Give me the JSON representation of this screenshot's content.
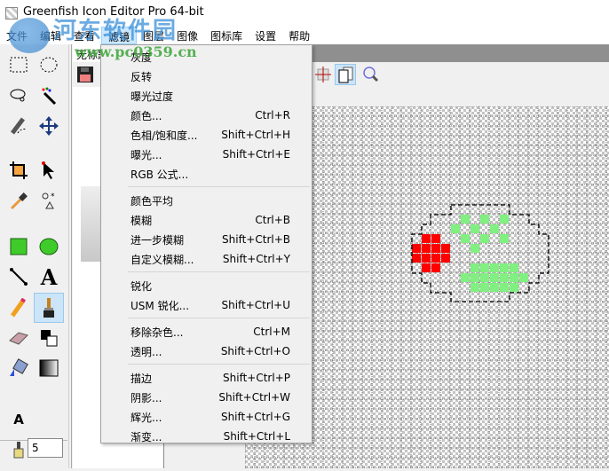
{
  "window": {
    "title": "Greenfish Icon Editor Pro 64-bit"
  },
  "watermark": {
    "text": "河东软件园",
    "url": "www.pc0359.cn"
  },
  "menubar": [
    "文件",
    "编辑",
    "查看",
    "滤镜",
    "图层",
    "图像",
    "图标库",
    "设置",
    "帮助"
  ],
  "active_menu": "滤镜",
  "document": {
    "tab_title": "无标题"
  },
  "brush_size": "5",
  "filter_menu": {
    "groups": [
      [
        {
          "label": "灰度",
          "shortcut": ""
        },
        {
          "label": "反转",
          "shortcut": ""
        },
        {
          "label": "曝光过度",
          "shortcut": ""
        },
        {
          "label": "颜色...",
          "shortcut": "Ctrl+R"
        },
        {
          "label": "色相/饱和度...",
          "shortcut": "Shift+Ctrl+H"
        },
        {
          "label": "曝光...",
          "shortcut": "Shift+Ctrl+E"
        },
        {
          "label": "RGB 公式...",
          "shortcut": ""
        }
      ],
      [
        {
          "label": "颜色平均",
          "shortcut": ""
        },
        {
          "label": "模糊",
          "shortcut": "Ctrl+B"
        },
        {
          "label": "进一步模糊",
          "shortcut": "Shift+Ctrl+B"
        },
        {
          "label": "自定义模糊...",
          "shortcut": "Shift+Ctrl+Y"
        }
      ],
      [
        {
          "label": "锐化",
          "shortcut": ""
        },
        {
          "label": "USM 锐化...",
          "shortcut": "Shift+Ctrl+U"
        }
      ],
      [
        {
          "label": "移除杂色...",
          "shortcut": "Ctrl+M"
        },
        {
          "label": "透明...",
          "shortcut": "Shift+Ctrl+O"
        }
      ],
      [
        {
          "label": "描边",
          "shortcut": "Shift+Ctrl+P"
        },
        {
          "label": "阴影...",
          "shortcut": "Shift+Ctrl+W"
        },
        {
          "label": "辉光...",
          "shortcut": "Shift+Ctrl+G"
        },
        {
          "label": "渐变...",
          "shortcut": "Shift+Ctrl+L"
        }
      ]
    ]
  },
  "colors": {
    "pixel_red": "#ff0000",
    "pixel_green": "#80f080",
    "menu_highlight": "#cce8ff"
  }
}
